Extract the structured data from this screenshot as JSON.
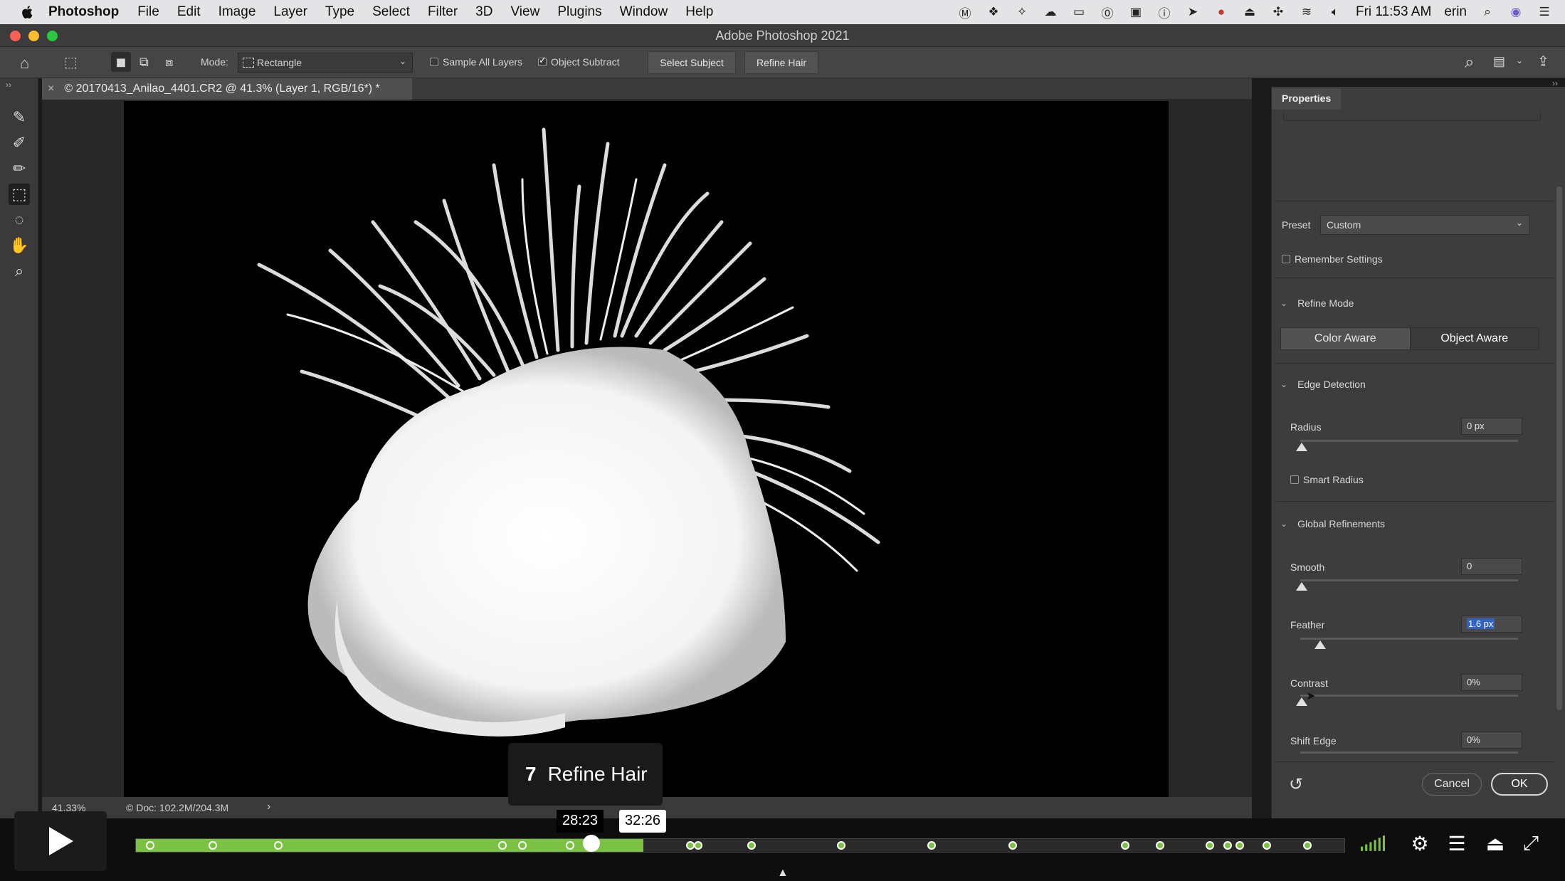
{
  "menubar": {
    "app_name": "Photoshop",
    "items": [
      "File",
      "Edit",
      "Image",
      "Layer",
      "Type",
      "Select",
      "Filter",
      "3D",
      "View",
      "Plugins",
      "Window",
      "Help"
    ],
    "clock": "Fri 11:53 AM",
    "user": "erin"
  },
  "window": {
    "title": "Adobe Photoshop 2021"
  },
  "options": {
    "mode_label": "Mode:",
    "mode_value": "Rectangle",
    "sample_all_layers": "Sample All Layers",
    "object_subtract": "Object Subtract",
    "select_subject": "Select Subject",
    "refine_hair": "Refine Hair"
  },
  "document": {
    "tab_title": "© 20170413_Anilao_4401.CR2 @ 41.3% (Layer 1, RGB/16*) *",
    "zoom": "41.33%",
    "doc_size": "© Doc: 102.2M/204.3M"
  },
  "properties": {
    "tab": "Properties",
    "preset_label": "Preset",
    "preset_value": "Custom",
    "remember_settings": "Remember Settings",
    "refine_mode": {
      "title": "Refine Mode",
      "color_aware": "Color Aware",
      "object_aware": "Object Aware"
    },
    "edge_detection": {
      "title": "Edge Detection",
      "radius_label": "Radius",
      "radius_value": "0 px",
      "smart_radius": "Smart Radius"
    },
    "global_refinements": {
      "title": "Global Refinements",
      "smooth_label": "Smooth",
      "smooth_value": "0",
      "feather_label": "Feather",
      "feather_value": "1.6 px",
      "contrast_label": "Contrast",
      "contrast_value": "0%",
      "shift_edge_label": "Shift Edge",
      "shift_edge_value": "0%"
    },
    "cancel": "Cancel",
    "ok": "OK"
  },
  "player": {
    "chapter_number": "7",
    "chapter_title": "Refine Hair",
    "hover_time": "28:23",
    "current_time": "32:26",
    "played_fraction": 0.42,
    "accent_color": "#7bc242"
  }
}
